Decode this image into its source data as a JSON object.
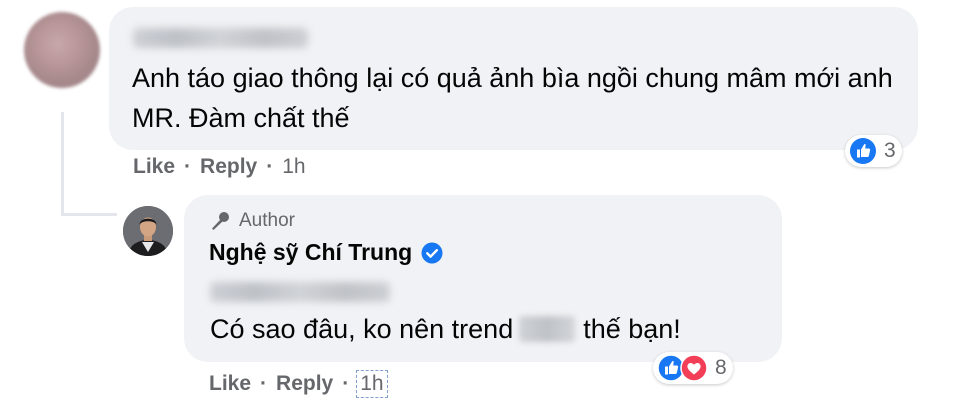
{
  "comment": {
    "author_name": "Namu Hai Hoi",
    "text": "Anh táo giao thông lại có quả ảnh bìa ngồi chung mâm mới anh MR. Đàm chất thế",
    "actions": {
      "like": "Like",
      "reply": "Reply",
      "separator": "·",
      "time": "1h"
    },
    "reactions": {
      "icons": [
        "like-icon"
      ],
      "count": "3"
    }
  },
  "reply": {
    "badge": {
      "icon": "microphone-icon",
      "label": "Author"
    },
    "author_name": "Nghệ sỹ Chí Trung",
    "verified_icon": "verified-badge-icon",
    "mention_name": "Namu Hai Hoi",
    "text_before": "Có sao đâu, ko nên trend",
    "text_after": "thế bạn!",
    "actions": {
      "like": "Like",
      "reply": "Reply",
      "separator": "·",
      "time": "1h"
    },
    "reactions": {
      "icons": [
        "like-icon",
        "love-icon"
      ],
      "count": "8"
    }
  },
  "colors": {
    "bubble": "#f0f2f5",
    "secondary_text": "#65676b",
    "like_blue": "#1877f2",
    "love_red": "#f33e58",
    "thread_line": "#e4e6eb"
  }
}
